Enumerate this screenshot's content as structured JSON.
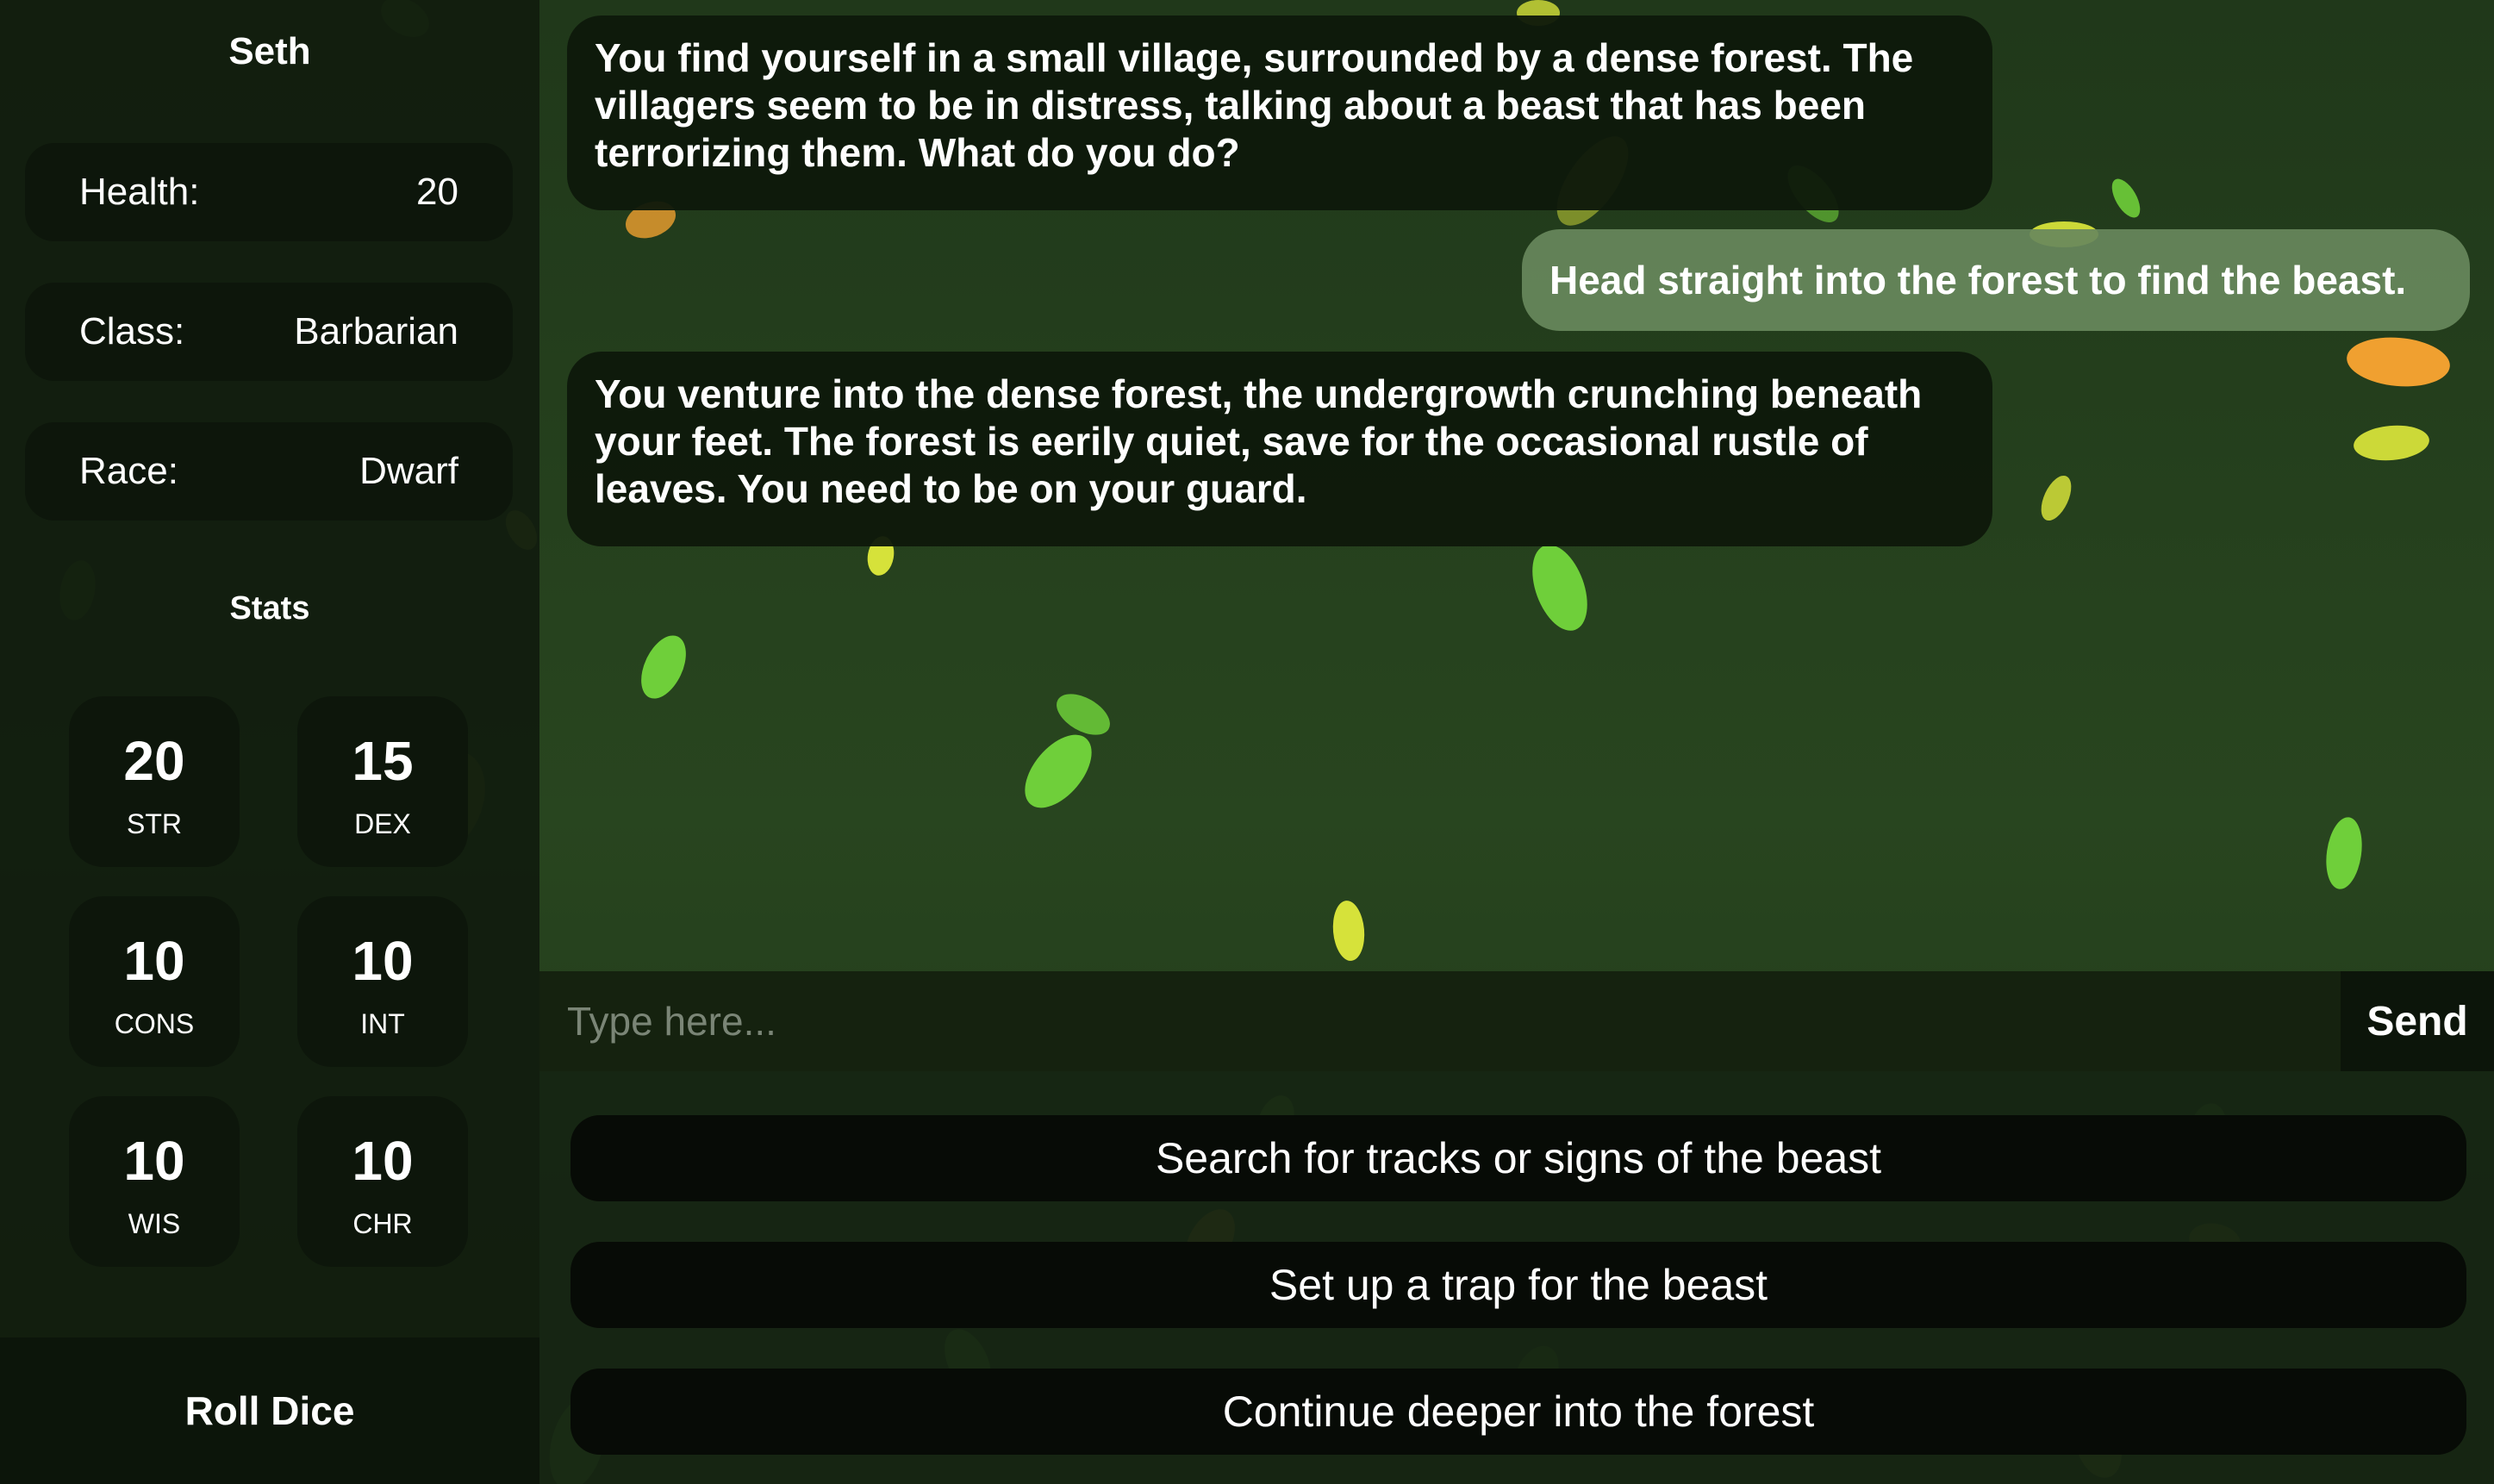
{
  "player": {
    "name": "Seth",
    "health_label": "Health:",
    "health_value": "20",
    "class_label": "Class:",
    "class_value": "Barbarian",
    "race_label": "Race:",
    "race_value": "Dwarf"
  },
  "stats": {
    "heading": "Stats",
    "items": [
      {
        "value": "20",
        "abbr": "STR"
      },
      {
        "value": "15",
        "abbr": "DEX"
      },
      {
        "value": "10",
        "abbr": "CONS"
      },
      {
        "value": "10",
        "abbr": "INT"
      },
      {
        "value": "10",
        "abbr": "WIS"
      },
      {
        "value": "10",
        "abbr": "CHR"
      }
    ]
  },
  "roll_dice_label": "Roll Dice",
  "chat": {
    "messages": [
      {
        "role": "narrator",
        "text": "You find yourself in a small village, surrounded by a dense forest. The villagers seem to be in distress, talking about a beast that has been terrorizing them. What do you do?"
      },
      {
        "role": "player",
        "text": "Head straight into the forest to find the beast."
      },
      {
        "role": "narrator",
        "text": "You venture into the dense forest, the undergrowth crunching beneath your feet. The forest is eerily quiet, save for the occasional rustle of leaves. You need to be on your guard."
      }
    ]
  },
  "input": {
    "placeholder": "Type here...",
    "value": "",
    "send_label": "Send"
  },
  "choices": [
    "Search for tracks or signs of the beast",
    "Set up a trap for the beast",
    "Continue deeper into the forest"
  ],
  "colors": {
    "background": "#243d1d",
    "sidebar": "#111c0e",
    "panel_dark": "#0d160b",
    "user_bubble": "#68885c",
    "leaf_green": "#6fcf3a",
    "leaf_yellow": "#d6e23a",
    "leaf_orange": "#f0a030"
  }
}
